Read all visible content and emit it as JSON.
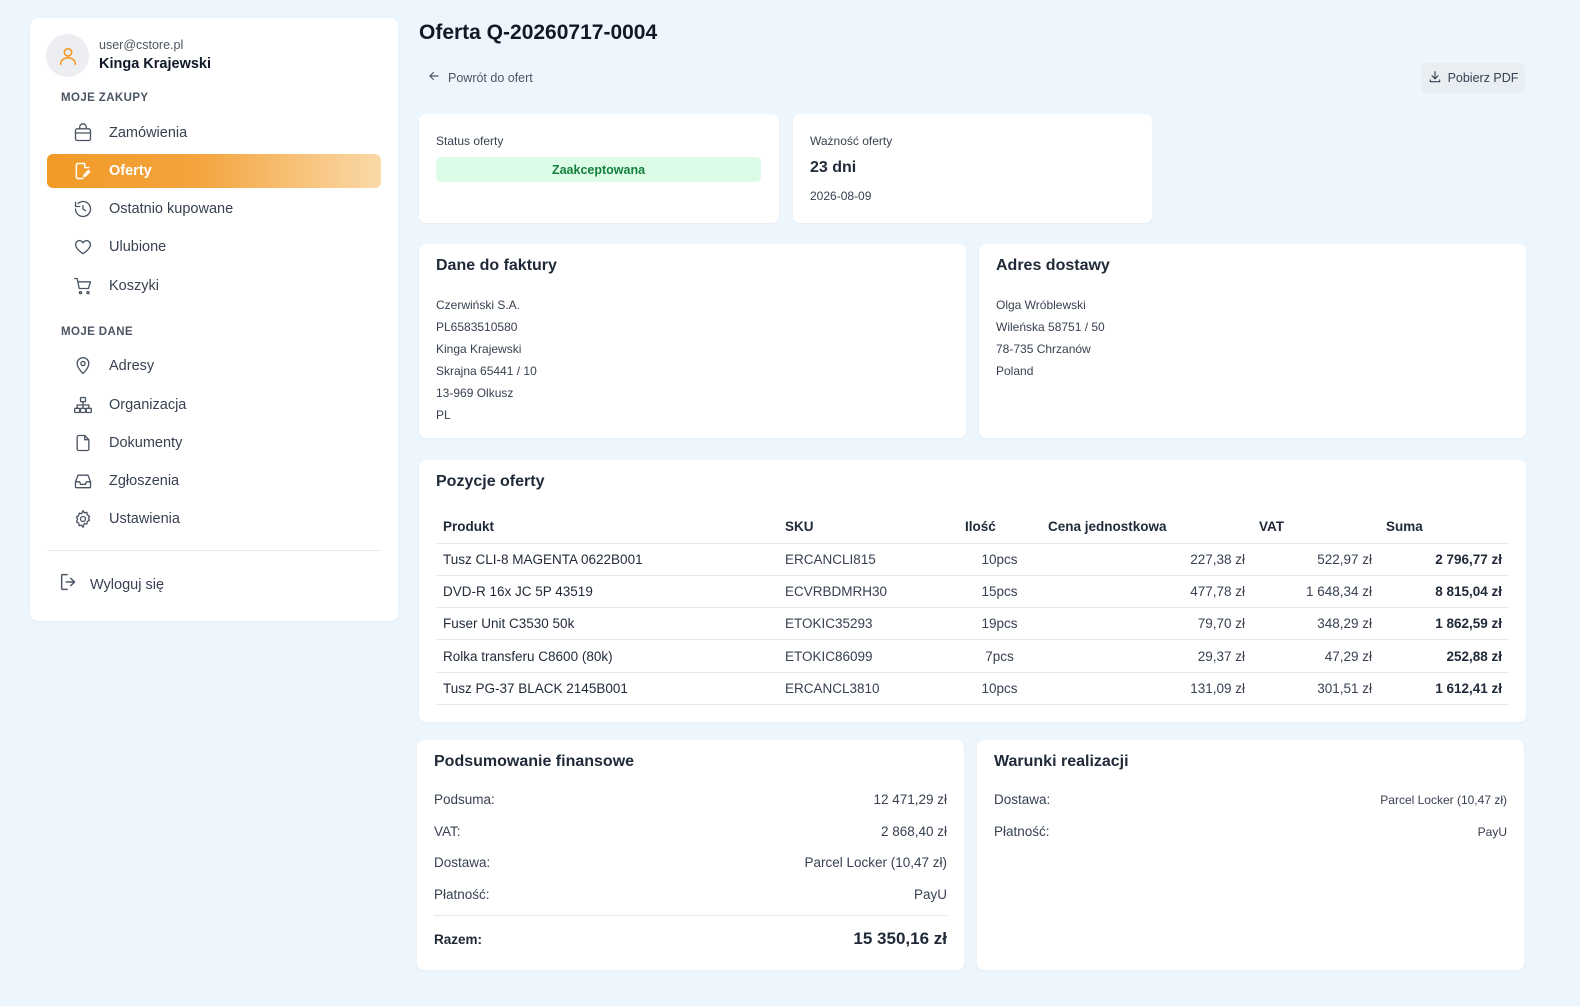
{
  "user": {
    "email": "user@cstore.pl",
    "name": "Kinga Krajewski"
  },
  "sidebar": {
    "section_purchases": "MOJE ZAKUPY",
    "section_data": "MOJE DANE",
    "items": [
      {
        "label": "Zamówienia",
        "icon": "shopping-bag-icon"
      },
      {
        "label": "Oferty",
        "icon": "edit-document-icon",
        "active": true
      },
      {
        "label": "Ostatnio kupowane",
        "icon": "history-icon"
      },
      {
        "label": "Ulubione",
        "icon": "heart-icon"
      },
      {
        "label": "Koszyki",
        "icon": "cart-icon"
      },
      {
        "label": "Adresy",
        "icon": "location-pin-icon"
      },
      {
        "label": "Organizacja",
        "icon": "org-chart-icon"
      },
      {
        "label": "Dokumenty",
        "icon": "document-icon"
      },
      {
        "label": "Zgłoszenia",
        "icon": "inbox-icon"
      },
      {
        "label": "Ustawienia",
        "icon": "gear-icon"
      }
    ],
    "logout": "Wyloguj się",
    "accent_color": "#f29a27"
  },
  "header": {
    "title": "Oferta Q-20260717-0004",
    "back_label": "Powrót do ofert",
    "pdf_label": "Pobierz PDF"
  },
  "status": {
    "label": "Status oferty",
    "value": "Zaakceptowana",
    "color": "#15803d"
  },
  "validity": {
    "label": "Ważność oferty",
    "days": "23 dni",
    "date": "2026-08-09"
  },
  "invoice": {
    "title": "Dane do faktury",
    "lines": [
      "Czerwiński S.A.",
      "PL6583510580",
      "Kinga Krajewski",
      "Skrajna 65441 / 10",
      "13-969 Olkusz",
      "PL"
    ]
  },
  "delivery": {
    "title": "Adres dostawy",
    "lines": [
      "Olga Wróblewski",
      "Wileńska 58751 / 50",
      "78-735 Chrzanów",
      "Poland"
    ]
  },
  "items": {
    "title": "Pozycje oferty",
    "columns": [
      "Produkt",
      "SKU",
      "Ilość",
      "Cena jednostkowa",
      "VAT",
      "Suma"
    ],
    "rows": [
      {
        "product": "Tusz CLI-8 MAGENTA 0622B001",
        "sku": "ERCANCLI815",
        "qty": "10pcs",
        "unit_price": "227,38 zł",
        "vat": "522,97 zł",
        "sum": "2 796,77 zł"
      },
      {
        "product": "DVD-R 16x JC 5P 43519",
        "sku": "ECVRBDMRH30",
        "qty": "15pcs",
        "unit_price": "477,78 zł",
        "vat": "1 648,34 zł",
        "sum": "8 815,04 zł"
      },
      {
        "product": "Fuser Unit C3530 50k",
        "sku": "ETOKIC35293",
        "qty": "19pcs",
        "unit_price": "79,70 zł",
        "vat": "348,29 zł",
        "sum": "1 862,59 zł"
      },
      {
        "product": "Rolka transferu C8600 (80k)",
        "sku": "ETOKIC86099",
        "qty": "7pcs",
        "unit_price": "29,37 zł",
        "vat": "47,29 zł",
        "sum": "252,88 zł"
      },
      {
        "product": "Tusz PG-37 BLACK 2145B001",
        "sku": "ERCANCL3810",
        "qty": "10pcs",
        "unit_price": "131,09 zł",
        "vat": "301,51 zł",
        "sum": "1 612,41 zł"
      }
    ]
  },
  "financial": {
    "title": "Podsumowanie finansowe",
    "subtotal_label": "Podsuma:",
    "subtotal": "12 471,29 zł",
    "vat_label": "VAT:",
    "vat": "2 868,40 zł",
    "shipping_label": "Dostawa:",
    "shipping": "Parcel Locker (10,47 zł)",
    "payment_label": "Płatność:",
    "payment": "PayU",
    "total_label": "Razem:",
    "total": "15 350,16 zł"
  },
  "conditions": {
    "title": "Warunki realizacji",
    "shipping_label": "Dostawa:",
    "shipping": "Parcel Locker (10,47 zł)",
    "payment_label": "Płatność:",
    "payment": "PayU"
  }
}
